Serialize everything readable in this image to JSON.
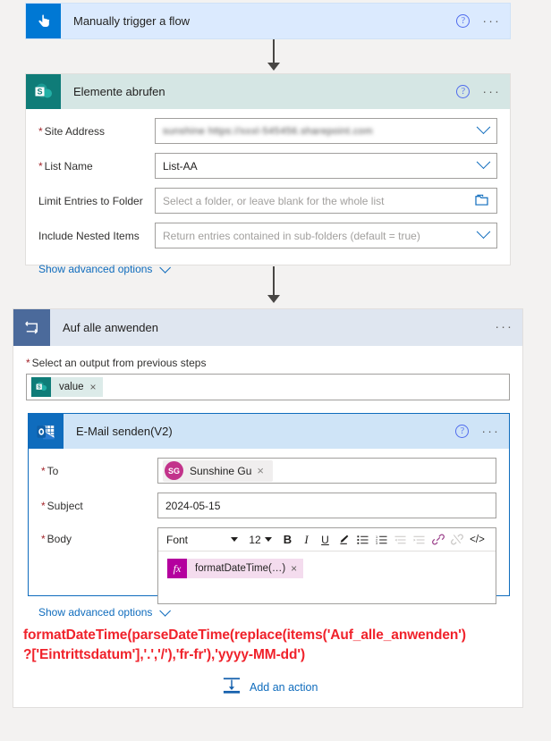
{
  "trigger": {
    "title": "Manually trigger a flow",
    "icon": "tap-hand-icon",
    "help_label": "?",
    "more_label": "···"
  },
  "sharepoint": {
    "title": "Elemente abrufen",
    "icon": "sharepoint-icon",
    "fields": [
      {
        "label": "Site Address",
        "required": true,
        "value": "sunshine  https://xxxl-545456.sharepoint.com",
        "blurred": true,
        "control": "dropdown"
      },
      {
        "label": "List Name",
        "required": true,
        "value": "List-AA",
        "blurred": false,
        "control": "dropdown"
      },
      {
        "label": "Limit Entries to Folder",
        "required": false,
        "placeholder": "Select a folder, or leave blank for the whole list",
        "control": "folder-picker"
      },
      {
        "label": "Include Nested Items",
        "required": false,
        "placeholder": "Return entries contained in sub-folders (default = true)",
        "control": "dropdown"
      }
    ],
    "advanced_label": "Show advanced options"
  },
  "loop": {
    "title": "Auf alle anwenden",
    "icon": "loop-icon",
    "output_label": "Select an output from previous steps",
    "output_required": true,
    "token": {
      "text": "value",
      "icon": "sharepoint-icon",
      "remove": "×"
    }
  },
  "email": {
    "title": "E-Mail senden(V2)",
    "icon": "outlook-icon",
    "to": {
      "label": "To",
      "required": true,
      "recipient": "Sunshine Gu",
      "initials": "SG",
      "remove": "×"
    },
    "subject": {
      "label": "Subject",
      "required": true,
      "value": "2024-05-15"
    },
    "body": {
      "label": "Body",
      "required": true,
      "font_name": "Font",
      "font_size": "12",
      "toolbar": [
        {
          "name": "bold-icon",
          "glyph": "B",
          "dim": false
        },
        {
          "name": "italic-icon",
          "glyph": "I",
          "dim": false
        },
        {
          "name": "underline-icon",
          "glyph": "U",
          "dim": false
        },
        {
          "name": "highlighter-pen-icon",
          "glyph": "✐",
          "dim": false
        },
        {
          "name": "bulleted-list-icon",
          "glyph": "☰",
          "dim": false
        },
        {
          "name": "numbered-list-icon",
          "glyph": "☰",
          "dim": false
        },
        {
          "name": "decrease-indent-icon",
          "glyph": "☰",
          "dim": true
        },
        {
          "name": "increase-indent-icon",
          "glyph": "☰",
          "dim": true
        },
        {
          "name": "link-icon",
          "glyph": "⚭",
          "dim": false
        },
        {
          "name": "unlink-icon",
          "glyph": "⚭",
          "dim": true
        },
        {
          "name": "code-view-icon",
          "glyph": "</>",
          "dim": false
        }
      ],
      "token": {
        "badge": "fx",
        "text": "formatDateTime(…)",
        "remove": "×"
      }
    },
    "advanced_label": "Show advanced options"
  },
  "annotation": {
    "line1": "formatDateTime(parseDateTime(replace(items('Auf_alle_anwenden')",
    "line2": "?['Eintrittsdatum'],'.','/'),'fr-fr'),'yyyy-MM-dd')",
    "color": "#f0222b"
  },
  "add_action": {
    "label": "Add an action",
    "icon": "add-action-icon"
  },
  "colors": {
    "trigger_header": "#dbeafe",
    "trigger_icon": "#0078d4",
    "sharepoint_header": "#d5e6e4",
    "sharepoint_icon": "#0f7c78",
    "loop_header": "#dfe6f0",
    "loop_icon": "#4b6a9b",
    "email_header": "#cfe4f7",
    "email_icon": "#0f6cbd",
    "link": "#0f6cbd",
    "required": "#a4262c",
    "fx_badge": "#b4009e",
    "avatar": "#c2338b",
    "page_background": "#f3f2f1"
  }
}
